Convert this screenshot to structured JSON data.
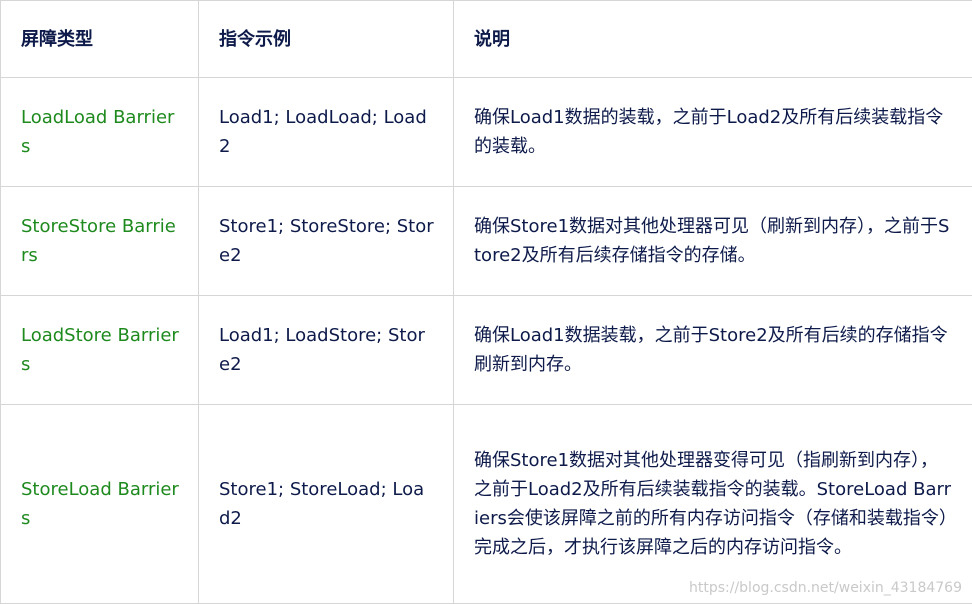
{
  "table": {
    "headers": [
      "屏障类型",
      "指令示例",
      "说明"
    ],
    "rows": [
      {
        "type": "LoadLoad Barriers",
        "example": "Load1; LoadLoad; Load2",
        "description": "确保Load1数据的装载，之前于Load2及所有后续装载指令的装载。"
      },
      {
        "type": "StoreStore Barriers",
        "example": "Store1; StoreStore; Store2",
        "description": "确保Store1数据对其他处理器可见（刷新到内存），之前于Store2及所有后续存储指令的存储。"
      },
      {
        "type": "LoadStore Barriers",
        "example": "Load1; LoadStore; Store2",
        "description": "确保Load1数据装载，之前于Store2及所有后续的存储指令刷新到内存。"
      },
      {
        "type": "StoreLoad Barriers",
        "example": "Store1; StoreLoad; Load2",
        "description": "确保Store1数据对其他处理器变得可见（指刷新到内存），之前于Load2及所有后续装载指令的装载。StoreLoad Barriers会使该屏障之前的所有内存访问指令（存储和装载指令）完成之后，才执行该屏障之后的内存访问指令。"
      }
    ]
  },
  "watermark": "https://blog.csdn.net/weixin_43184769",
  "colors": {
    "type_text": "#1e8a1e",
    "body_text": "#0d1a4a",
    "border": "#d6d6d6"
  }
}
